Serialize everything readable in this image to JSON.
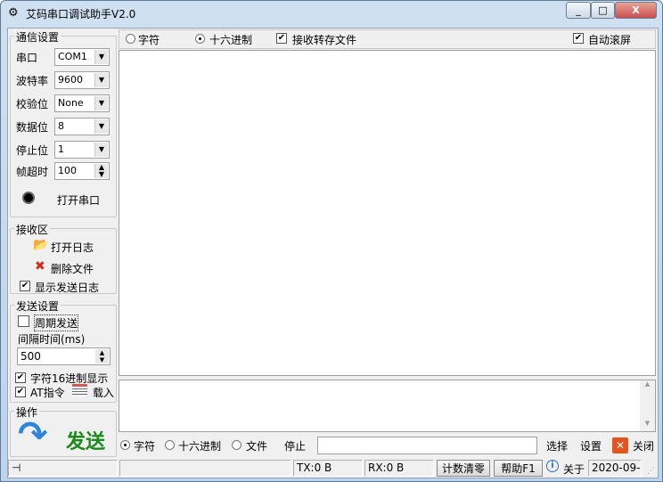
{
  "window": {
    "title": "艾码串口调试助手V2.0",
    "minimize": "_",
    "maximize": "□",
    "close": "X"
  },
  "comm": {
    "group": "通信设置",
    "rows": [
      {
        "label": "串口",
        "value": "COM1",
        "type": "combo"
      },
      {
        "label": "波特率",
        "value": "9600",
        "type": "combo"
      },
      {
        "label": "校验位",
        "value": "None",
        "type": "combo"
      },
      {
        "label": "数据位",
        "value": "8",
        "type": "combo"
      },
      {
        "label": "停止位",
        "value": "1",
        "type": "combo"
      },
      {
        "label": "帧超时",
        "value": "100",
        "type": "spin"
      }
    ],
    "open_port": "打开串口"
  },
  "receive_area": {
    "group": "接收区",
    "open_log": "打开日志",
    "delete_file": "删除文件",
    "show_send_log": "显示发送日志",
    "show_send_log_checked": true
  },
  "send_settings": {
    "group": "发送设置",
    "periodic": "周期发送",
    "periodic_checked": false,
    "interval_label": "间隔时间(ms)",
    "interval": "500",
    "hex_display": "字符16进制显示",
    "hex_display_checked": true,
    "at_cmd": "AT指令",
    "at_checked": true,
    "load": "载入"
  },
  "operate": {
    "group": "操作",
    "send": "发送"
  },
  "recv_toolbar": {
    "char": "字符",
    "hex": "十六进制",
    "mode": "hex",
    "save_file": "接收转存文件",
    "save_file_checked": true,
    "auto_scroll": "自动滚屏",
    "auto_scroll_checked": true
  },
  "send_bar": {
    "char": "字符",
    "hex": "十六进制",
    "file": "文件",
    "mode": "char",
    "stop": "停止",
    "file_path": "",
    "select": "选择",
    "settings": "设置",
    "close": "关闭"
  },
  "status": {
    "tx": "TX:0 B",
    "rx": "RX:0 B",
    "clear": "计数清零",
    "help": "帮助F1",
    "about": "关于",
    "date": "2020-09-:"
  },
  "colors": {
    "send_text": "#1a8a1a",
    "send_arrow": "#2f86d8",
    "close_icon": "#e8541d"
  }
}
